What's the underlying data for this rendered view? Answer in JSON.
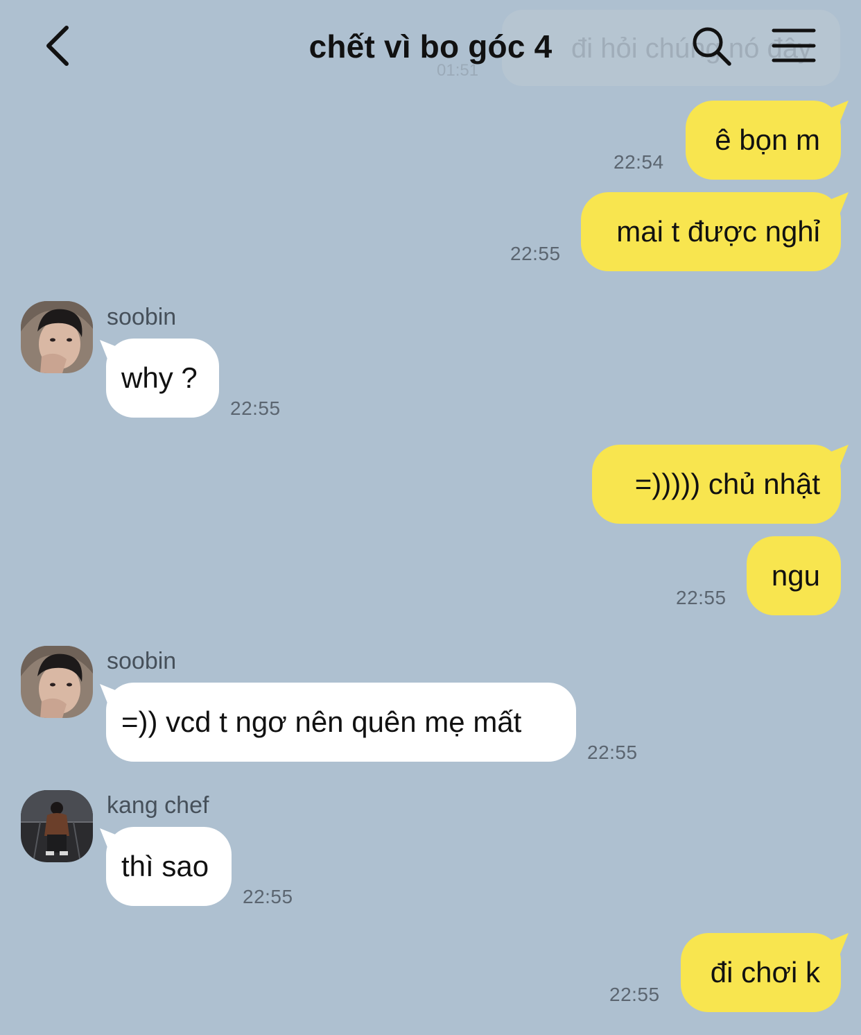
{
  "header": {
    "title": "chết vì bo góc 4",
    "ghost_text": "đi hỏi chúng nó đây",
    "ghost_time": "01:51"
  },
  "messages": [
    {
      "side": "me",
      "text": "ê bọn m",
      "time": "22:54"
    },
    {
      "side": "me",
      "text": "mai t được nghỉ",
      "time": "22:55"
    },
    {
      "side": "them",
      "sender": "soobin",
      "text": "why ?",
      "time": "22:55"
    },
    {
      "side": "me",
      "text": "=))))) chủ nhật",
      "time": ""
    },
    {
      "side": "me",
      "text": "ngu",
      "time": "22:55"
    },
    {
      "side": "them",
      "sender": "soobin",
      "text": "=)) vcd t ngơ nên quên mẹ mất",
      "time": "22:55"
    },
    {
      "side": "them",
      "sender": "kang chef",
      "text": "thì sao",
      "time": "22:55"
    },
    {
      "side": "me",
      "text": "đi chơi k",
      "time": "22:55"
    }
  ],
  "colors": {
    "background": "#aec0d0",
    "my_bubble": "#f8e54f",
    "their_bubble": "#ffffff"
  },
  "icons": [
    "chevron-left-icon",
    "search-icon",
    "menu-icon"
  ]
}
